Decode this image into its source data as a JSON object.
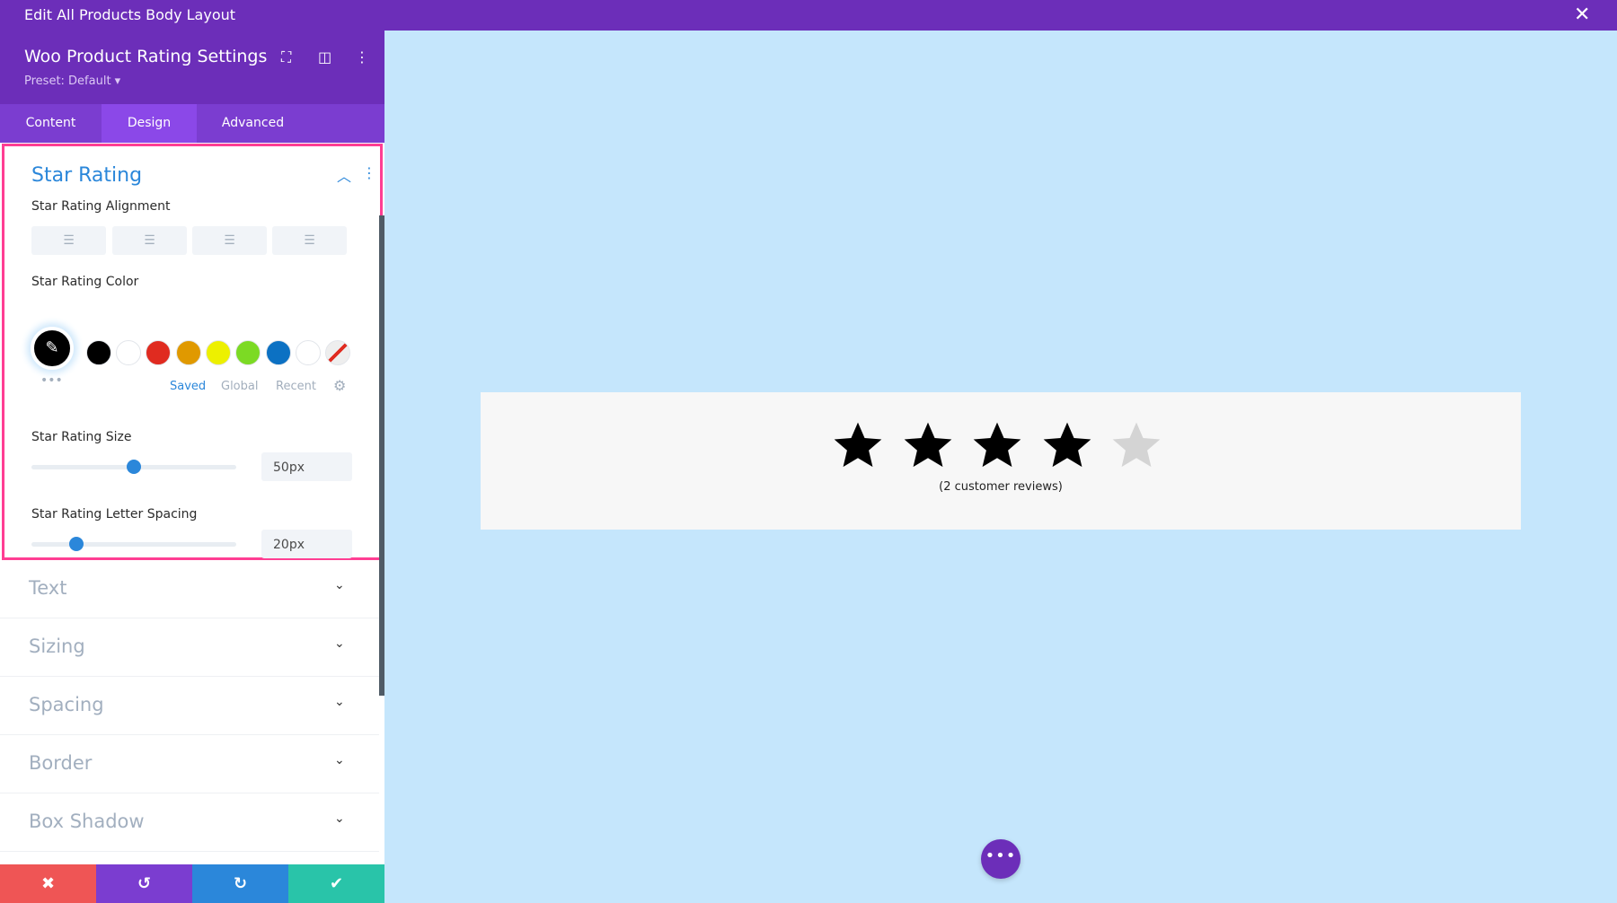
{
  "window": {
    "title": "Edit All Products Body Layout",
    "close_icon": "close-icon"
  },
  "panel": {
    "title": "Woo Product Rating Settings",
    "preset": "Preset: Default ▾",
    "tabs": [
      {
        "label": "Content"
      },
      {
        "label": "Design",
        "active": true
      },
      {
        "label": "Advanced"
      }
    ],
    "star_rating": {
      "title": "Star Rating",
      "alignment_label": "Star Rating Alignment",
      "color_label": "Star Rating Color",
      "selected_color": "#000000",
      "swatches": [
        "#000000",
        "#ffffff",
        "#e02b20",
        "#e09900",
        "#edf000",
        "#7cda24",
        "#0c71c3",
        "#ffffff",
        "none"
      ],
      "palette_tabs": [
        "Saved",
        "Global",
        "Recent"
      ],
      "active_palette_tab": "Saved",
      "size_label": "Star Rating Size",
      "size_value": "50px",
      "spacing_label": "Star Rating Letter Spacing",
      "spacing_value": "20px"
    },
    "sections": [
      "Text",
      "Sizing",
      "Spacing",
      "Border",
      "Box Shadow"
    ]
  },
  "preview": {
    "rating": 4,
    "max_rating": 5,
    "reviews": "(2 customer reviews)",
    "star_color": "#000000",
    "empty_star_color": "#d4d4d4"
  },
  "colors": {
    "purple": "#6c2eb9",
    "accent": "#2b87da",
    "highlight": "#ff3e93",
    "canvas": "#c5e6fc"
  }
}
